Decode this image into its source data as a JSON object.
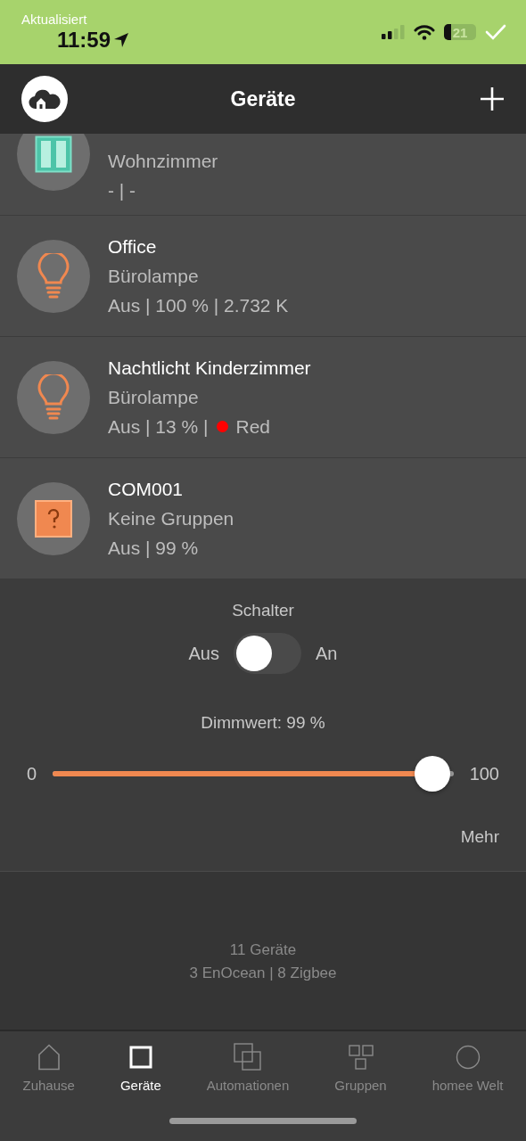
{
  "status_bar": {
    "banner": "Aktualisiert",
    "time": "11:59",
    "battery": "21"
  },
  "header": {
    "title": "Geräte"
  },
  "devices": [
    {
      "kind": "window",
      "room": "Wohnzimmer",
      "status": "- | -"
    },
    {
      "kind": "bulb",
      "name": "Office",
      "room": "Bürolampe",
      "status": "Aus | 100 % | 2.732 K"
    },
    {
      "kind": "bulb",
      "name": "Nachtlicht Kinderzimmer",
      "room": "Bürolampe",
      "status": "Aus | 13 % |",
      "color_dot": {
        "color": "#ff0000",
        "label": "Red"
      }
    },
    {
      "kind": "unknown",
      "name": "COM001",
      "room": "Keine Gruppen",
      "status": "Aus | 99 %"
    }
  ],
  "detail": {
    "switch_title": "Schalter",
    "off_label": "Aus",
    "on_label": "An",
    "on": false,
    "dim_label": "Dimmwert: 99 %",
    "min": "0",
    "max": "100",
    "level": 0.99,
    "more": "Mehr"
  },
  "summary": [
    "11 Geräte",
    "3 EnOcean | 8 Zigbee"
  ],
  "tabs": [
    {
      "kind": "home",
      "label": "Zuhause",
      "selected": false
    },
    {
      "kind": "square",
      "label": "Geräte",
      "selected": true
    },
    {
      "kind": "overlap",
      "label": "Automationen",
      "selected": false
    },
    {
      "kind": "grid",
      "label": "Gruppen",
      "selected": false
    },
    {
      "kind": "circle",
      "label": "homee Welt",
      "selected": false
    }
  ]
}
